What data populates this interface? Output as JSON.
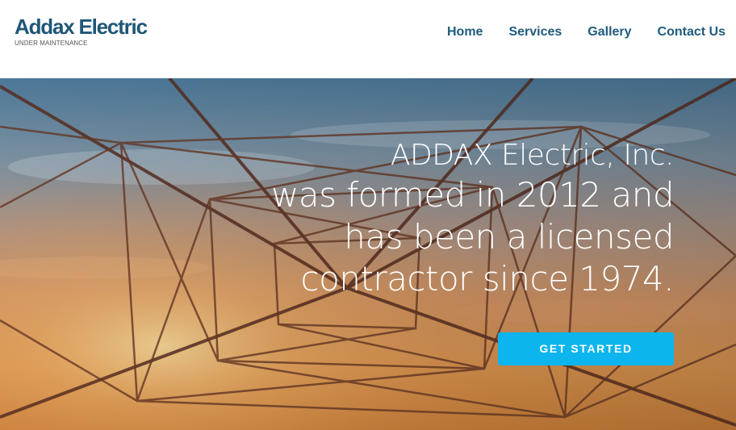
{
  "brand": {
    "name": "Addax Electric",
    "tagline": "UNDER MAINTENANCE",
    "color": "#1e5677"
  },
  "nav": {
    "items": [
      {
        "label": "Home"
      },
      {
        "label": "Services"
      },
      {
        "label": "Gallery"
      },
      {
        "label": "Contact Us"
      }
    ],
    "color": "#1f5b7c"
  },
  "hero": {
    "lines": [
      "ADDAX Electric, Inc.",
      "was formed in 2012 and",
      "has been a licensed",
      "contractor since 1974."
    ],
    "background": "sunset sky with electricity transmission tower lattice",
    "cta_label": "GET STARTED",
    "cta_color": "#0cb5ee"
  }
}
